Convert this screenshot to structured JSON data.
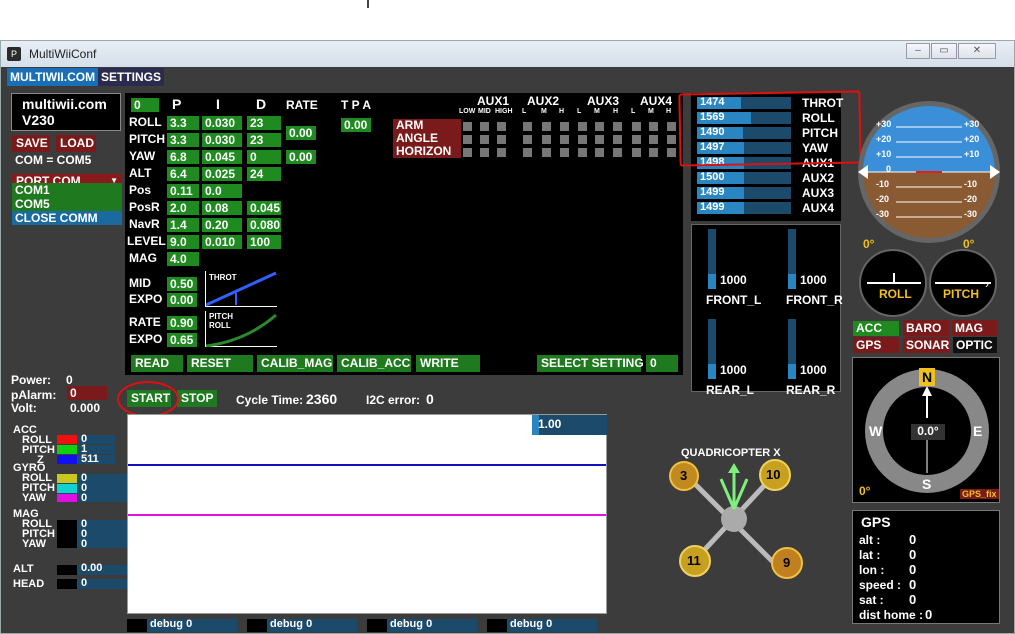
{
  "window": {
    "title": "MultiWiiConf"
  },
  "menu": {
    "site": "MULTIWII.COM",
    "settings": "SETTINGS"
  },
  "header": {
    "name": "multiwii.com",
    "version": "V230"
  },
  "buttons": {
    "save": "SAVE",
    "load": "LOAD",
    "start": "START",
    "stop": "STOP",
    "read": "READ",
    "reset": "RESET",
    "calib_mag": "CALIB_MAG",
    "calib_acc": "CALIB_ACC",
    "write": "WRITE",
    "select_setting": "SELECT SETTING",
    "select_setting_value": "0"
  },
  "port": {
    "com_status": "COM = COM5",
    "port_com": "PORT COM",
    "options": [
      "COM1",
      "COM5"
    ],
    "close": "CLOSE COMM"
  },
  "pid": {
    "profile": "0",
    "headers": {
      "p": "P",
      "i": "I",
      "d": "D",
      "rate": "RATE",
      "tpa": "T P A"
    },
    "rows": [
      {
        "name": "ROLL",
        "p": "3.3",
        "i": "0.030",
        "d": "23"
      },
      {
        "name": "PITCH",
        "p": "3.3",
        "i": "0.030",
        "d": "23"
      },
      {
        "name": "YAW",
        "p": "6.8",
        "i": "0.045",
        "d": "0"
      },
      {
        "name": "ALT",
        "p": "6.4",
        "i": "0.025",
        "d": "24"
      },
      {
        "name": "Pos",
        "p": "0.11",
        "i": "0.0",
        "d": ""
      },
      {
        "name": "PosR",
        "p": "2.0",
        "i": "0.08",
        "d": "0.045"
      },
      {
        "name": "NavR",
        "p": "1.4",
        "i": "0.20",
        "d": "0.080"
      },
      {
        "name": "LEVEL",
        "p": "9.0",
        "i": "0.010",
        "d": "100"
      },
      {
        "name": "MAG",
        "p": "4.0",
        "i": "",
        "d": ""
      }
    ],
    "rate_rollpitch": "0.00",
    "rate_yaw": "0.00",
    "tpa": "0.00",
    "throttle": {
      "mid_label": "MID",
      "mid": "0.50",
      "expo_label": "EXPO",
      "expo": "0.00",
      "curve_label": "THROT"
    },
    "rc": {
      "rate_label": "RATE",
      "rate": "0.90",
      "expo_label": "EXPO",
      "expo": "0.65",
      "curve_label1": "PITCH",
      "curve_label2": "ROLL"
    }
  },
  "aux": {
    "headers": [
      "AUX1",
      "AUX2",
      "AUX3",
      "AUX4"
    ],
    "sub": [
      "LOW",
      "MID",
      "HIGH",
      "L",
      "M",
      "H",
      "L",
      "M",
      "H",
      "L",
      "M",
      "H"
    ],
    "modes": [
      "ARM",
      "ANGLE",
      "HORIZON"
    ]
  },
  "rc_channels": [
    {
      "name": "THROT",
      "value": "1474",
      "level": 0.47
    },
    {
      "name": "ROLL",
      "value": "1569",
      "level": 0.57
    },
    {
      "name": "PITCH",
      "value": "1490",
      "level": 0.49
    },
    {
      "name": "YAW",
      "value": "1497",
      "level": 0.5
    },
    {
      "name": "AUX1",
      "value": "1498",
      "level": 0.5
    },
    {
      "name": "AUX2",
      "value": "1500",
      "level": 0.5
    },
    {
      "name": "AUX3",
      "value": "1499",
      "level": 0.5
    },
    {
      "name": "AUX4",
      "value": "1499",
      "level": 0.5
    }
  ],
  "motors": [
    {
      "name": "FRONT_L",
      "value": "1000",
      "level": 0.25
    },
    {
      "name": "FRONT_R",
      "value": "1000",
      "level": 0.25
    },
    {
      "name": "REAR_L",
      "value": "1000",
      "level": 0.25
    },
    {
      "name": "REAR_R",
      "value": "1000",
      "level": 0.25
    }
  ],
  "horizon": {
    "ticks": [
      "+30",
      "+20",
      "+10",
      "0",
      "-10",
      "-20",
      "-30"
    ],
    "roll_deg": "0°",
    "pitch_deg": "0°",
    "roll_label": "ROLL",
    "pitch_label": "PITCH"
  },
  "sensors": {
    "acc": "ACC",
    "baro": "BARO",
    "mag": "MAG",
    "gps": "GPS",
    "sonar": "SONAR",
    "optic": "OPTIC"
  },
  "compass": {
    "n": "N",
    "s": "S",
    "e": "E",
    "w": "W",
    "heading": "0.0°",
    "gps_deg": "0°",
    "gps_fix": "GPS_fix"
  },
  "gps": {
    "title": "GPS",
    "rows": [
      {
        "k": "alt :",
        "v": "0"
      },
      {
        "k": "lat :",
        "v": "0"
      },
      {
        "k": "lon :",
        "v": "0"
      },
      {
        "k": "speed :",
        "v": "0"
      },
      {
        "k": "sat :",
        "v": "0"
      },
      {
        "k": "dist home :",
        "v": "0"
      }
    ]
  },
  "status": {
    "power_label": "Power:",
    "power": "0",
    "palarm_label": "pAlarm:",
    "palarm": "0",
    "volt_label": "Volt:",
    "volt": "0.000",
    "cycle_label": "Cycle Time:",
    "cycle": "2360",
    "i2c_label": "I2C error:",
    "i2c": "0"
  },
  "sensor_values": {
    "acc": {
      "title": "ACC",
      "roll_label": "ROLL",
      "roll": "0",
      "pitch_label": "PITCH",
      "pitch": "1",
      "z_label": "Z",
      "z": "511"
    },
    "gyro": {
      "title": "GYRO",
      "roll_label": "ROLL",
      "roll": "0",
      "pitch_label": "PITCH",
      "pitch": "0",
      "yaw_label": "YAW",
      "yaw": "0"
    },
    "mag": {
      "title": "MAG",
      "roll_label": "ROLL",
      "roll": "0",
      "pitch_label": "PITCH",
      "pitch": "0",
      "yaw_label": "YAW",
      "yaw": "0"
    },
    "alt": {
      "title": "ALT",
      "value": "0.00"
    },
    "head": {
      "title": "HEAD",
      "value": "0"
    }
  },
  "graph": {
    "scale": "1.00"
  },
  "quad": {
    "title": "QUADRICOPTER X",
    "m3": "3",
    "m10": "10",
    "m11": "11",
    "m9": "9"
  },
  "debug": [
    {
      "label": "debug",
      "v": "0"
    },
    {
      "label": "debug",
      "v": "0"
    },
    {
      "label": "debug",
      "v": "0"
    },
    {
      "label": "debug",
      "v": "0"
    }
  ],
  "colors": {
    "annotation": "#e01010",
    "green": "#1f8a1f",
    "darkred": "#7a1a1a",
    "blue": "#2a86c3"
  }
}
